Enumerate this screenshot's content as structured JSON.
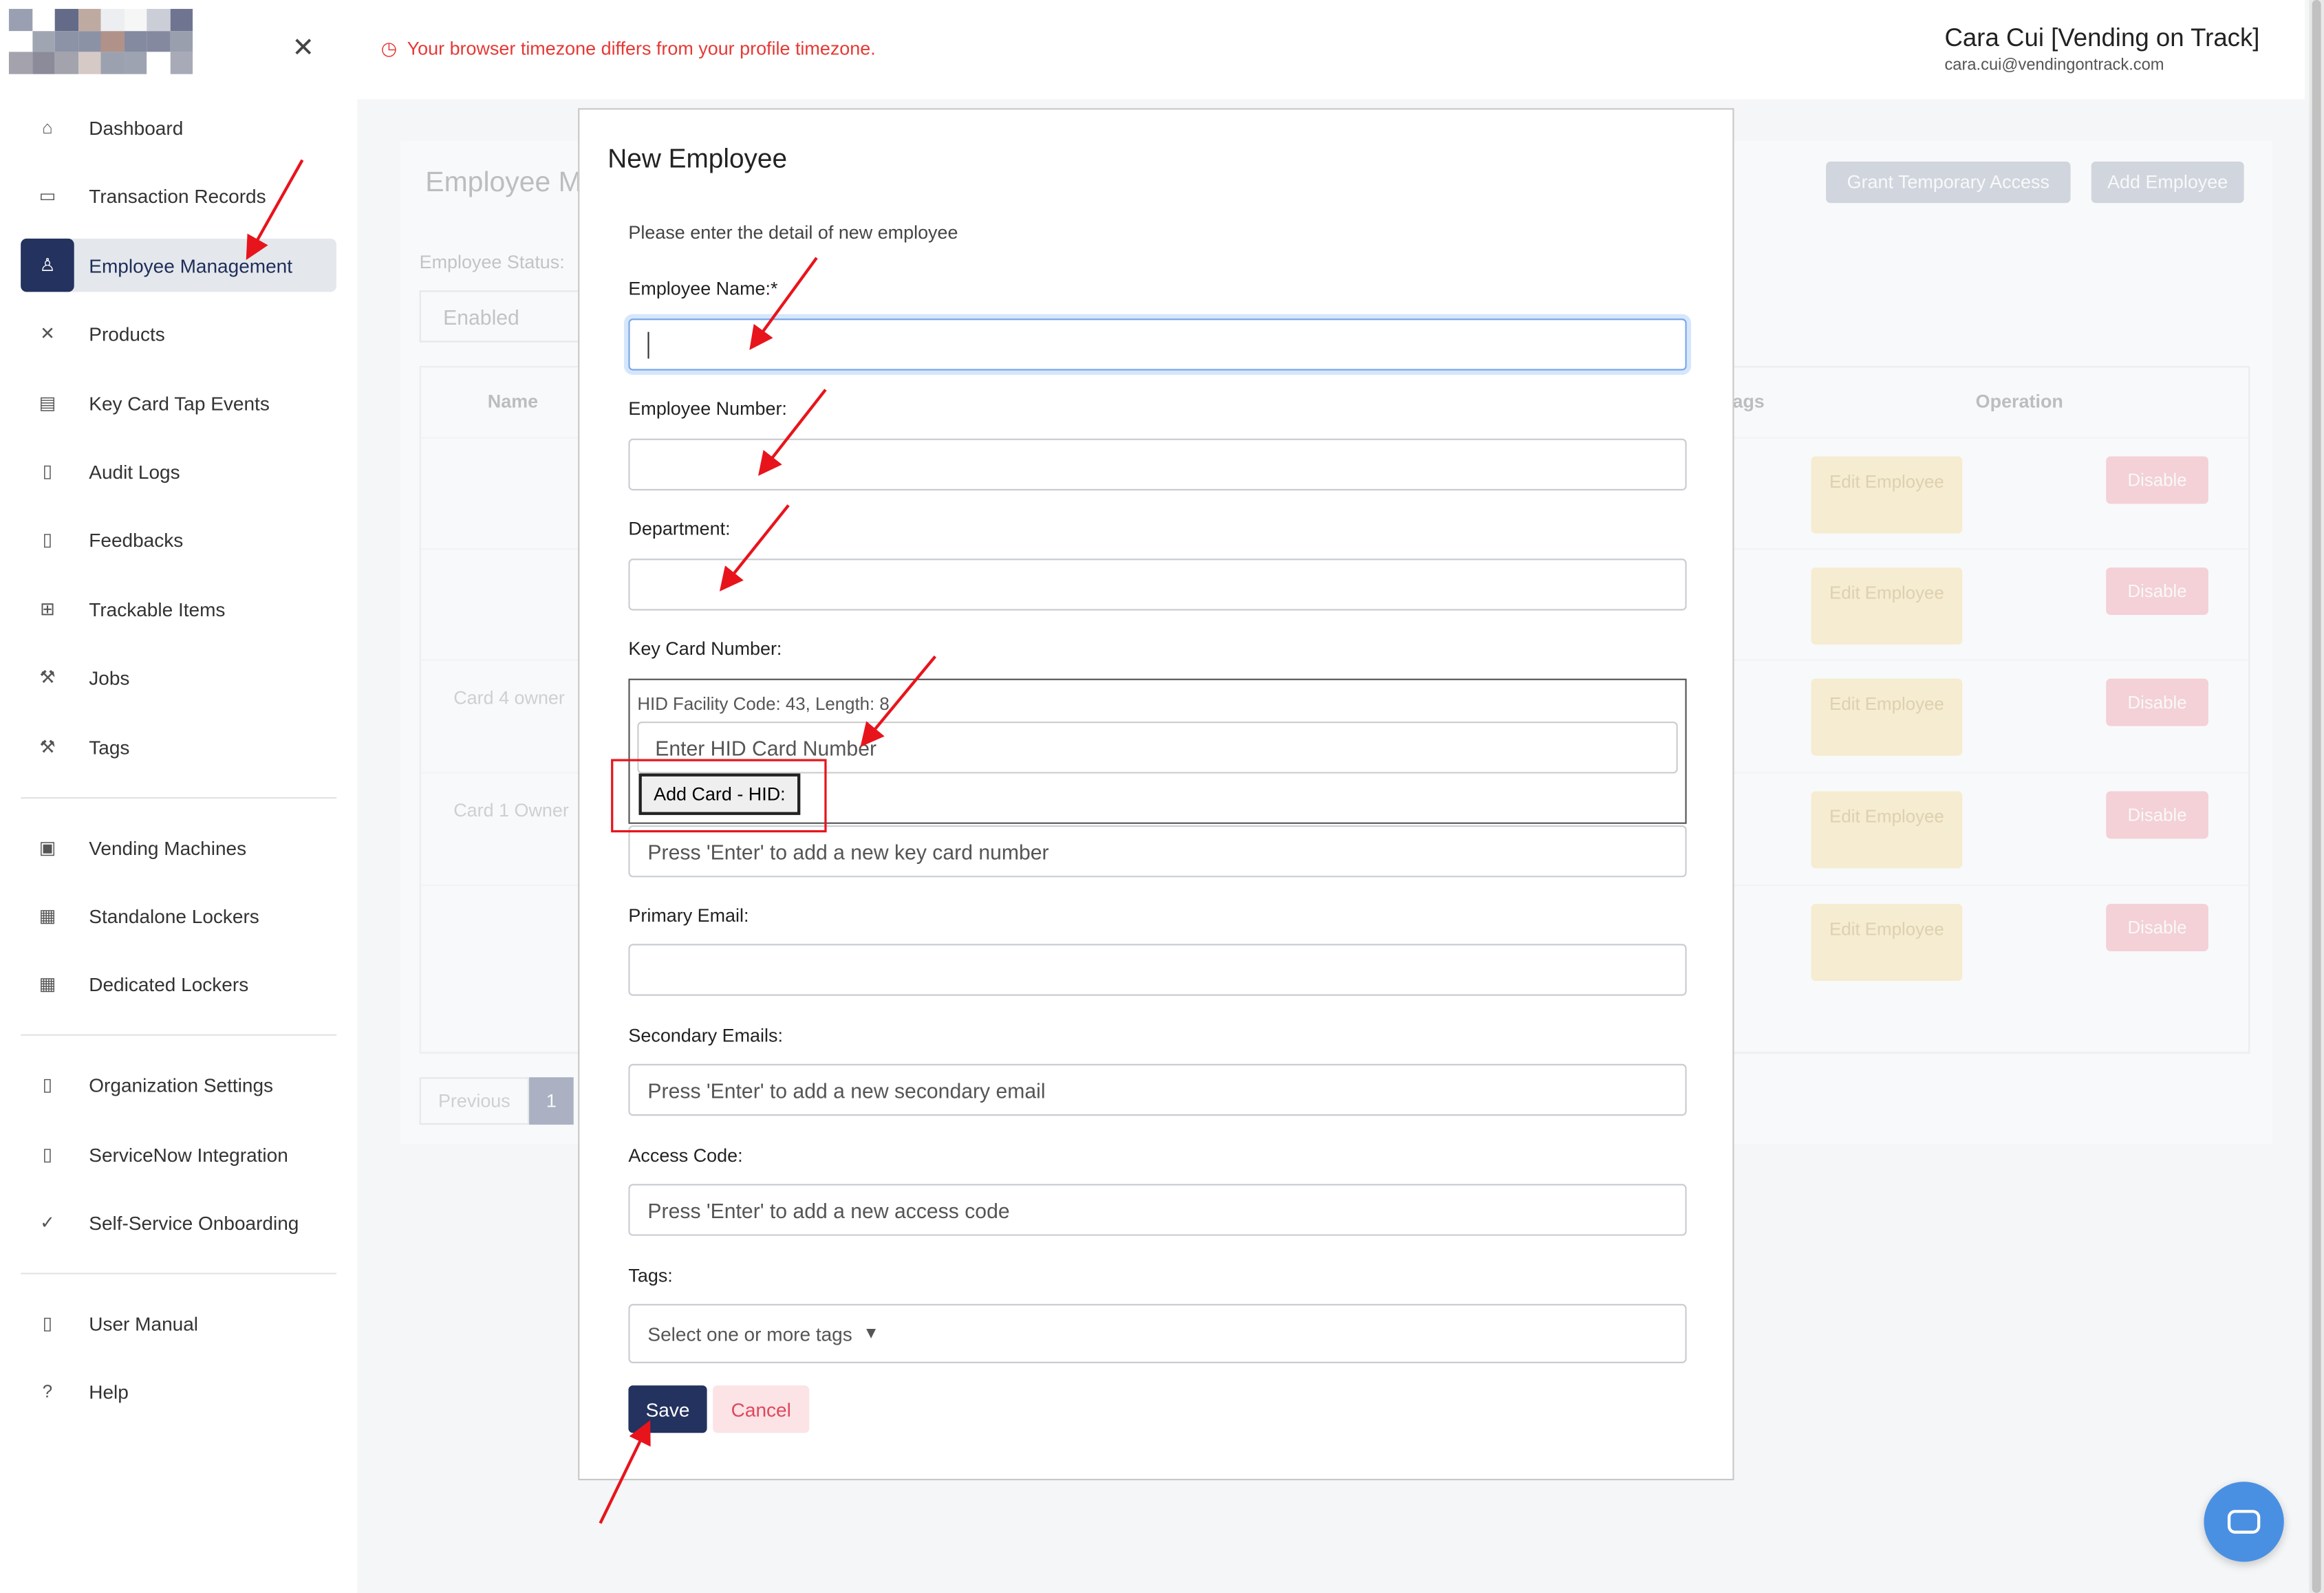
{
  "sidebar": {
    "close_icon": "close-icon",
    "items": [
      {
        "label": "Dashboard",
        "icon": "home-icon"
      },
      {
        "label": "Transaction Records",
        "icon": "receipt-icon"
      },
      {
        "label": "Employee Management",
        "icon": "user-icon",
        "active": true
      },
      {
        "label": "Products",
        "icon": "tools-icon"
      },
      {
        "label": "Key Card Tap Events",
        "icon": "id-card-icon"
      },
      {
        "label": "Audit Logs",
        "icon": "document-icon"
      },
      {
        "label": "Feedbacks",
        "icon": "document-icon"
      },
      {
        "label": "Trackable Items",
        "icon": "sitemap-icon"
      },
      {
        "label": "Jobs",
        "icon": "hammer-icon"
      },
      {
        "label": "Tags",
        "icon": "hammer-icon"
      },
      {
        "label": "Vending Machines",
        "icon": "machine-icon"
      },
      {
        "label": "Standalone Lockers",
        "icon": "grid-icon"
      },
      {
        "label": "Dedicated Lockers",
        "icon": "grid-icon"
      },
      {
        "label": "Organization Settings",
        "icon": "document-icon"
      },
      {
        "label": "ServiceNow Integration",
        "icon": "document-icon"
      },
      {
        "label": "Self-Service Onboarding",
        "icon": "check-circle-icon"
      },
      {
        "label": "User Manual",
        "icon": "book-icon"
      },
      {
        "label": "Help",
        "icon": "question-icon"
      }
    ]
  },
  "header": {
    "warning": "Your browser timezone differs from your profile timezone.",
    "user_name": "Cara Cui [Vending on Track]",
    "user_email": "cara.cui@vendingontrack.com"
  },
  "background": {
    "title": "Employee M",
    "grant_label": "Grant Temporary Access",
    "add_label": "Add Employee",
    "status_label": "Employee Status:",
    "status_value": "Enabled",
    "col_name": "Name",
    "col_tags": "ags",
    "col_operation": "Operation",
    "rows": [
      {
        "name": ""
      },
      {
        "name": ""
      },
      {
        "name": "Card 4 owner"
      },
      {
        "name": "Card 1 Owner"
      },
      {
        "name": ""
      }
    ],
    "edit_label": "Edit Employee",
    "disable_label": "Disable",
    "prev_label": "Previous",
    "page": "1"
  },
  "modal": {
    "title": "New Employee",
    "subtitle": "Please enter the detail of new employee",
    "name_label": "Employee Name:*",
    "number_label": "Employee Number:",
    "dept_label": "Department:",
    "keycard_label": "Key Card Number:",
    "hid_info": "HID Facility Code: 43, Length: 8",
    "hid_placeholder": "Enter HID Card Number",
    "add_card_label": "Add Card - HID:",
    "keycard_placeholder": "Press 'Enter' to add a new key card number",
    "primary_label": "Primary Email:",
    "secondary_label": "Secondary Emails:",
    "secondary_placeholder": "Press 'Enter' to add a new secondary email",
    "access_label": "Access Code:",
    "access_placeholder": "Press 'Enter' to add a new access code",
    "tags_label": "Tags:",
    "tags_placeholder": "Select one or more tags",
    "save_label": "Save",
    "cancel_label": "Cancel"
  },
  "colors": {
    "navy": "#23325e",
    "warning": "#e53935",
    "annotation": "#e8141c"
  }
}
